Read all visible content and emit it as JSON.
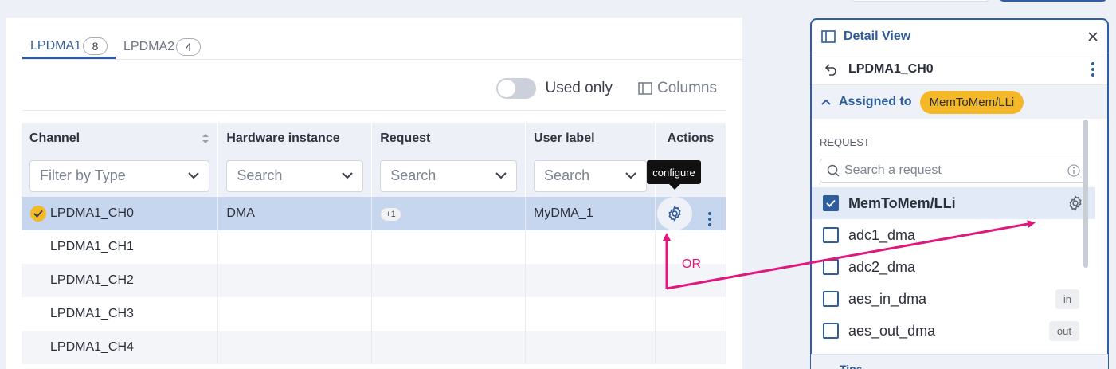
{
  "tabs": [
    {
      "label": "LPDMA1",
      "count": "8"
    },
    {
      "label": "LPDMA2",
      "count": "4"
    }
  ],
  "toolbar": {
    "used_only": "Used only",
    "columns": "Columns"
  },
  "table": {
    "headers": {
      "channel": "Channel",
      "hardware": "Hardware instance",
      "request": "Request",
      "user_label": "User label",
      "actions": "Actions"
    },
    "filters": {
      "channel": "Filter by Type",
      "hardware": "Search",
      "request": "Search",
      "user_label": "Search"
    },
    "rows": [
      {
        "channel": "LPDMA1_CH0",
        "hardware": "DMA",
        "request": "+1",
        "user_label": "MyDMA_1"
      },
      {
        "channel": "LPDMA1_CH1",
        "hardware": "",
        "request": "",
        "user_label": ""
      },
      {
        "channel": "LPDMA1_CH2",
        "hardware": "",
        "request": "",
        "user_label": ""
      },
      {
        "channel": "LPDMA1_CH3",
        "hardware": "",
        "request": "",
        "user_label": ""
      },
      {
        "channel": "LPDMA1_CH4",
        "hardware": "",
        "request": "",
        "user_label": ""
      }
    ]
  },
  "tooltip": "configure",
  "annotation": {
    "or": "OR",
    "color": "#e0177d"
  },
  "panel": {
    "title": "Detail View",
    "name": "LPDMA1_CH0",
    "assigned_label": "Assigned to",
    "assigned_value": "MemToMem/LLi",
    "request_label": "REQUEST",
    "search_placeholder": "Search a request",
    "items": [
      {
        "label": "MemToMem/LLi",
        "checked": true,
        "tag": ""
      },
      {
        "label": "adc1_dma",
        "checked": false,
        "tag": ""
      },
      {
        "label": "adc2_dma",
        "checked": false,
        "tag": ""
      },
      {
        "label": "aes_in_dma",
        "checked": false,
        "tag": "in"
      },
      {
        "label": "aes_out_dma",
        "checked": false,
        "tag": "out"
      }
    ],
    "tips": "Tips"
  }
}
